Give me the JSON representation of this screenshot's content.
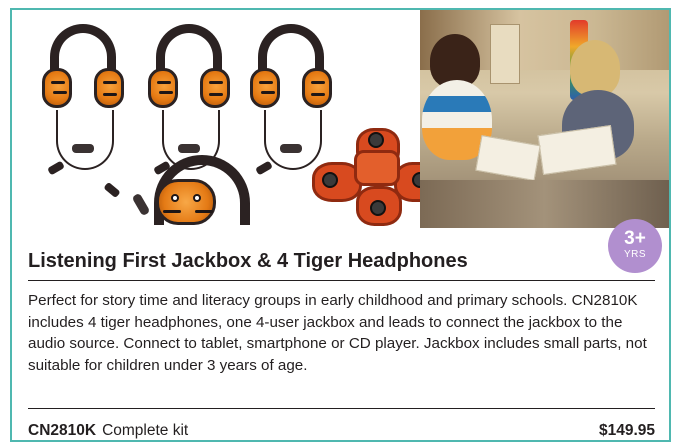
{
  "product": {
    "title": "Listening First Jackbox & 4 Tiger Headphones",
    "age_badge": {
      "age": "3+",
      "unit": "YRS"
    },
    "description": "Perfect for story time and literacy groups in early childhood and primary schools. CN2810K includes 4 tiger headphones, one 4-user jackbox and leads to connect the jackbox to the audio source. Connect to tablet, smartphone or CD player. Jackbox includes small parts, not suitable for children under 3 years of age.",
    "sku": "CN2810K",
    "sku_description": "Complete kit",
    "price": "$149.95"
  },
  "colors": {
    "border": "#4fb8b0",
    "badge": "#b18fcf",
    "tiger_orange": "#e57a13",
    "jackbox_red": "#d84a1f",
    "text": "#231f20"
  },
  "icons": [
    "tiger-headphone-icon",
    "jackbox-icon"
  ]
}
